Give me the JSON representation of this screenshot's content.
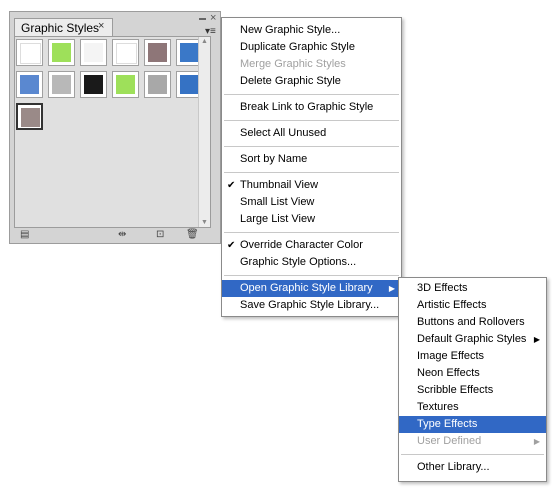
{
  "panel": {
    "tab_label": "Graphic Styles",
    "tab_close": "×",
    "close_glyph": "×",
    "menu_glyph": "▾≡",
    "swatches": [
      {
        "color": "#ffffff",
        "icon": "default-none-icon"
      },
      {
        "color": "#9ee05a",
        "icon": "green-glow-icon"
      },
      {
        "color": "#f4f4f4",
        "icon": "soft-white-icon"
      },
      {
        "color": "#ffffff",
        "icon": "white-icon"
      },
      {
        "color": "#8e7678",
        "icon": "mauve-icon"
      },
      {
        "color": "#3a78c8",
        "icon": "blue-bevel-icon"
      },
      {
        "color": "#5a88d0",
        "icon": "blue-texture-icon"
      },
      {
        "color": "#b8b8b8",
        "icon": "gray-shard-icon"
      },
      {
        "color": "#1a1a1a",
        "icon": "black-rough-icon"
      },
      {
        "color": "#9ee05a",
        "icon": "green-soft-icon"
      },
      {
        "color": "#a8a8a8",
        "icon": "gray-shadow-icon"
      },
      {
        "color": "#3572c4",
        "icon": "blue-gradient-icon"
      },
      {
        "color": "#9a8a88",
        "icon": "metal-texture-icon"
      }
    ],
    "bottom_icons": [
      "library-menu-icon",
      "break-link-icon",
      "new-style-icon",
      "trash-icon"
    ]
  },
  "main_menu": {
    "items": [
      {
        "label": "New Graphic Style...",
        "state": "normal"
      },
      {
        "label": "Duplicate Graphic Style",
        "state": "normal"
      },
      {
        "label": "Merge Graphic Styles",
        "state": "disabled"
      },
      {
        "label": "Delete Graphic Style",
        "state": "normal"
      },
      {
        "label": "Break Link to Graphic Style",
        "state": "normal"
      },
      {
        "label": "Select All Unused",
        "state": "normal"
      },
      {
        "label": "Sort by Name",
        "state": "normal"
      },
      {
        "label": "Thumbnail View",
        "state": "checked"
      },
      {
        "label": "Small List View",
        "state": "normal"
      },
      {
        "label": "Large List View",
        "state": "normal"
      },
      {
        "label": "Override Character Color",
        "state": "checked"
      },
      {
        "label": "Graphic Style Options...",
        "state": "normal"
      },
      {
        "label": "Open Graphic Style Library",
        "state": "highlight-submenu"
      },
      {
        "label": "Save Graphic Style Library...",
        "state": "normal"
      }
    ]
  },
  "sub_menu": {
    "items": [
      {
        "label": "3D Effects",
        "state": "normal"
      },
      {
        "label": "Artistic Effects",
        "state": "normal"
      },
      {
        "label": "Buttons and Rollovers",
        "state": "normal"
      },
      {
        "label": "Default Graphic Styles",
        "state": "submenu"
      },
      {
        "label": "Image Effects",
        "state": "normal"
      },
      {
        "label": "Neon Effects",
        "state": "normal"
      },
      {
        "label": "Scribble Effects",
        "state": "normal"
      },
      {
        "label": "Textures",
        "state": "normal"
      },
      {
        "label": "Type Effects",
        "state": "highlight"
      },
      {
        "label": "User Defined",
        "state": "disabled-submenu"
      },
      {
        "label": "Other Library...",
        "state": "normal"
      }
    ]
  },
  "colors": {
    "highlight": "#3168c5",
    "disabled": "#a0a0a0"
  }
}
